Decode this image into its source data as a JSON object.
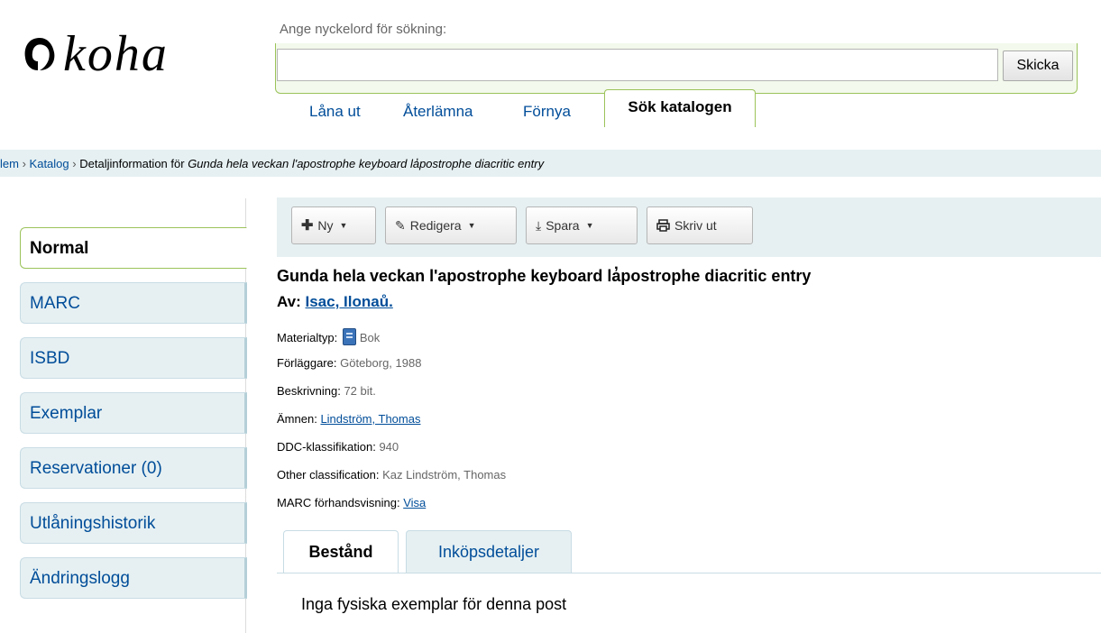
{
  "header": {
    "logo_text": "koha",
    "search_prompt": "Ange nyckelord för sökning:",
    "search_value": "",
    "search_button": "Skicka",
    "tabs": [
      {
        "label": "Låna ut"
      },
      {
        "label": "Återlämna"
      },
      {
        "label": "Förnya"
      },
      {
        "label": "Sök katalogen"
      }
    ]
  },
  "breadcrumbs": {
    "home": "lem",
    "catalog": "Katalog",
    "current_prefix": "Detaljinformation för",
    "current_title": "Gunda hela veckan l'apostrophe keyboard la̓postrophe diacritic entry"
  },
  "sidebar": {
    "items": [
      {
        "label": "Normal",
        "active": true
      },
      {
        "label": "MARC"
      },
      {
        "label": "ISBD"
      },
      {
        "label": "Exemplar"
      },
      {
        "label": "Reservationer (0)"
      },
      {
        "label": "Utlåningshistorik"
      },
      {
        "label": "Ändringslogg"
      }
    ]
  },
  "toolbar": {
    "new_label": "Ny",
    "edit_label": "Redigera",
    "save_label": "Spara",
    "print_label": "Skriv ut"
  },
  "record": {
    "title": "Gunda hela veckan l'apostrophe keyboard la̓postrophe diacritic entry",
    "author_prefix": "Av:",
    "author": "Isac, Ilonaů.",
    "fields": [
      {
        "label": "Materialtyp:",
        "value": "Bok",
        "type": "icon"
      },
      {
        "label": "Förläggare:",
        "value": "Göteborg, 1988"
      },
      {
        "label": "Beskrivning:",
        "value": "72 bit."
      },
      {
        "label": "Ämnen:",
        "value": "Lindström, Thomas",
        "link": true
      },
      {
        "label": "DDC-klassifikation:",
        "value": "940"
      },
      {
        "label": "Other classification:",
        "value": "Kaz Lindström, Thomas"
      },
      {
        "label": "MARC förhandsvisning:",
        "value": "Visa",
        "link": true
      }
    ]
  },
  "tabs": {
    "holdings": "Bestånd",
    "acquisitions": "Inköpsdetaljer",
    "holdings_text": "Inga fysiska exemplar för denna post"
  }
}
